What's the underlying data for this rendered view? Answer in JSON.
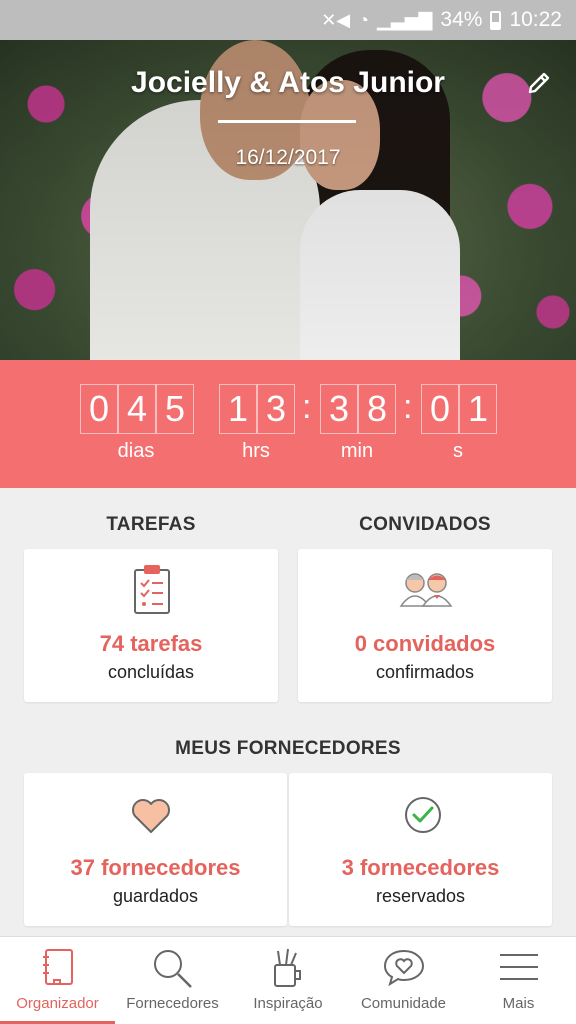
{
  "status_bar": {
    "battery": "34%",
    "time": "10:22"
  },
  "hero": {
    "couple_name": "Jocielly & Atos Junior",
    "wedding_date": "16/12/2017"
  },
  "countdown": {
    "days": [
      "0",
      "4",
      "5"
    ],
    "hours": [
      "1",
      "3"
    ],
    "minutes": [
      "3",
      "8"
    ],
    "seconds": [
      "0",
      "1"
    ],
    "labels": {
      "days": "dias",
      "hours": "hrs",
      "minutes": "min",
      "seconds": "s"
    }
  },
  "tasks": {
    "title": "TAREFAS",
    "value": "74 tarefas",
    "sub": "concluídas"
  },
  "guests": {
    "title": "CONVIDADOS",
    "value": "0 convidados",
    "sub": "confirmados"
  },
  "suppliers": {
    "title": "MEUS FORNECEDORES",
    "saved": {
      "value": "37 fornecedores",
      "sub": "guardados"
    },
    "booked": {
      "value": "3 fornecedores",
      "sub": "reservados"
    }
  },
  "nav": [
    {
      "label": "Organizador",
      "icon": "notebook-icon"
    },
    {
      "label": "Fornecedores",
      "icon": "search-icon"
    },
    {
      "label": "Inspiração",
      "icon": "pencil-cup-icon"
    },
    {
      "label": "Comunidade",
      "icon": "heart-chat-icon"
    },
    {
      "label": "Mais",
      "icon": "menu-icon"
    }
  ],
  "colors": {
    "accent": "#f36f70",
    "accent_text": "#e4635d",
    "background": "#efefef"
  }
}
